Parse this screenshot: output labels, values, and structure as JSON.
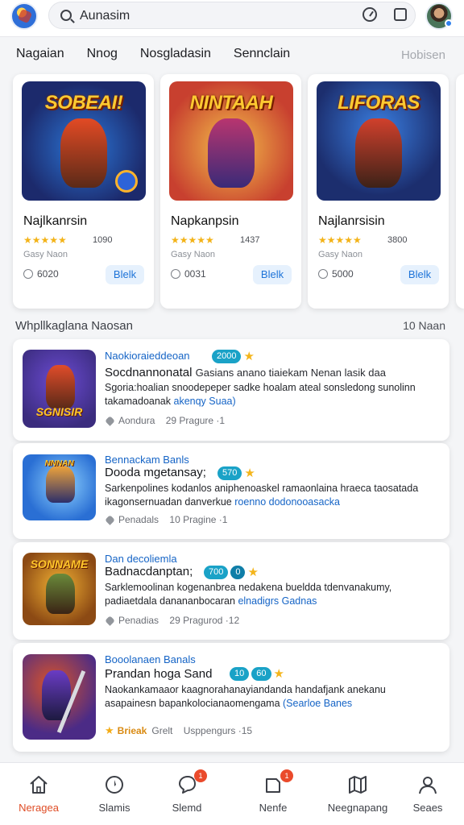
{
  "header": {
    "search": {
      "value": "Aunasim"
    }
  },
  "tabs": [
    "Nagaian",
    "Nnog",
    "Nosgladasin",
    "Sennclain"
  ],
  "tabs_more": "Hobisen",
  "featured": [
    {
      "thumb_title": "SOBEAI!",
      "name": "Najlkanrsin",
      "rating": "4.5",
      "review_count": "1090",
      "meta": "Gasy Naon",
      "size": "6020",
      "button": "Blelk",
      "colors": [
        "#1c2a6c",
        "#e24a24"
      ]
    },
    {
      "thumb_title": "NINTAAH",
      "name": "Napkanpsin",
      "rating": "4.5",
      "review_count": "1437",
      "meta": "Gasy Naon",
      "size": "0031",
      "button": "Blelk",
      "colors": [
        "#f0a020",
        "#b8356f"
      ]
    },
    {
      "thumb_title": "LIFORAS",
      "name": "Najlanrsisin",
      "rating": "4.5",
      "review_count": "3800",
      "meta": "Gasy Naon",
      "size": "5000",
      "button": "Blelk",
      "colors": [
        "#1c3a86",
        "#d0402c"
      ]
    }
  ],
  "section": {
    "title": "Whpllkaglana Naosan",
    "count": "10 Naan"
  },
  "list": [
    {
      "thumb_label": "SGNISIR",
      "thumb_colors": [
        "#3b2c7e",
        "#e04c2a"
      ],
      "category": "Naokioraieddeoan",
      "badges": [
        "2000"
      ],
      "title": "Socdnannonatal",
      "title_extra": "Gasians anano tiaiekam Nenan lasik daa",
      "desc": "Sgoria:hoalian snoodepeper sadke hoalam ateal sonsledong sunolinn takamadoanak",
      "link": "akenqy Suaa)",
      "foot_type": "heart",
      "foot_a": "Aondura",
      "foot_b": "29 Pragure ·1"
    },
    {
      "thumb_label": "NNNAN",
      "thumb_colors": [
        "#2a6fd4",
        "#f0a43a"
      ],
      "category": "Bennackam Banls",
      "badges": [
        "570"
      ],
      "title": "Dooda mgetansay;",
      "title_extra": "",
      "desc": "Sarkenpolines kodanlos aniphenoaskel ramaonlaina hraeca taosatada ikagonsernuadan danverkue",
      "link": "roenno dodonooasacka",
      "foot_type": "heart",
      "foot_a": "Penadals",
      "foot_b": "10 Pragine ·1"
    },
    {
      "thumb_label": "SONNAME",
      "thumb_colors": [
        "#8c4a14",
        "#f2b133"
      ],
      "category": "Dan decoliemla",
      "badges": [
        "700",
        "0"
      ],
      "title": "Badnacdanptan;",
      "title_extra": "",
      "desc": "Sarklemoolinan kogenanbrea nedakena bueldda tdenvanakumy, padiaetdala danananbocaran",
      "link": "elnadigrs Gadnas",
      "foot_type": "heart",
      "foot_a": "Penadias",
      "foot_b": "29 Pragurod ·12"
    },
    {
      "thumb_label": "",
      "thumb_colors": [
        "#4b2b86",
        "#d8532a"
      ],
      "category": "Booolanaen Banals",
      "badges": [
        "10",
        "60"
      ],
      "title": "Prandan hoga Sand",
      "title_extra": "",
      "desc": "Naokankamaaor kaagnorahanayiandanda handafjank anekanu asapainesn bapankolocianaomengama",
      "link": "(Searloe Banes",
      "foot_type": "star",
      "foot_a": "Brieak",
      "foot_a2": "Grelt",
      "foot_b": "Usppengurs ·15"
    }
  ],
  "nav": [
    {
      "label": "Neragea",
      "icon": "home-icon",
      "badge": ""
    },
    {
      "label": "Slamis",
      "icon": "compass-icon",
      "badge": ""
    },
    {
      "label": "Slemd",
      "icon": "chat-icon",
      "badge": "1"
    },
    {
      "label": "Nenfe",
      "icon": "notification-icon",
      "badge": "1"
    },
    {
      "label": "Neegnapang",
      "icon": "map-icon",
      "badge": ""
    },
    {
      "label": "Seaes",
      "icon": "profile-icon",
      "badge": ""
    }
  ],
  "colors": {
    "accent": "#df4c25",
    "link": "#1564c6",
    "badge": "#1aa2c7",
    "star": "#f3b318"
  }
}
